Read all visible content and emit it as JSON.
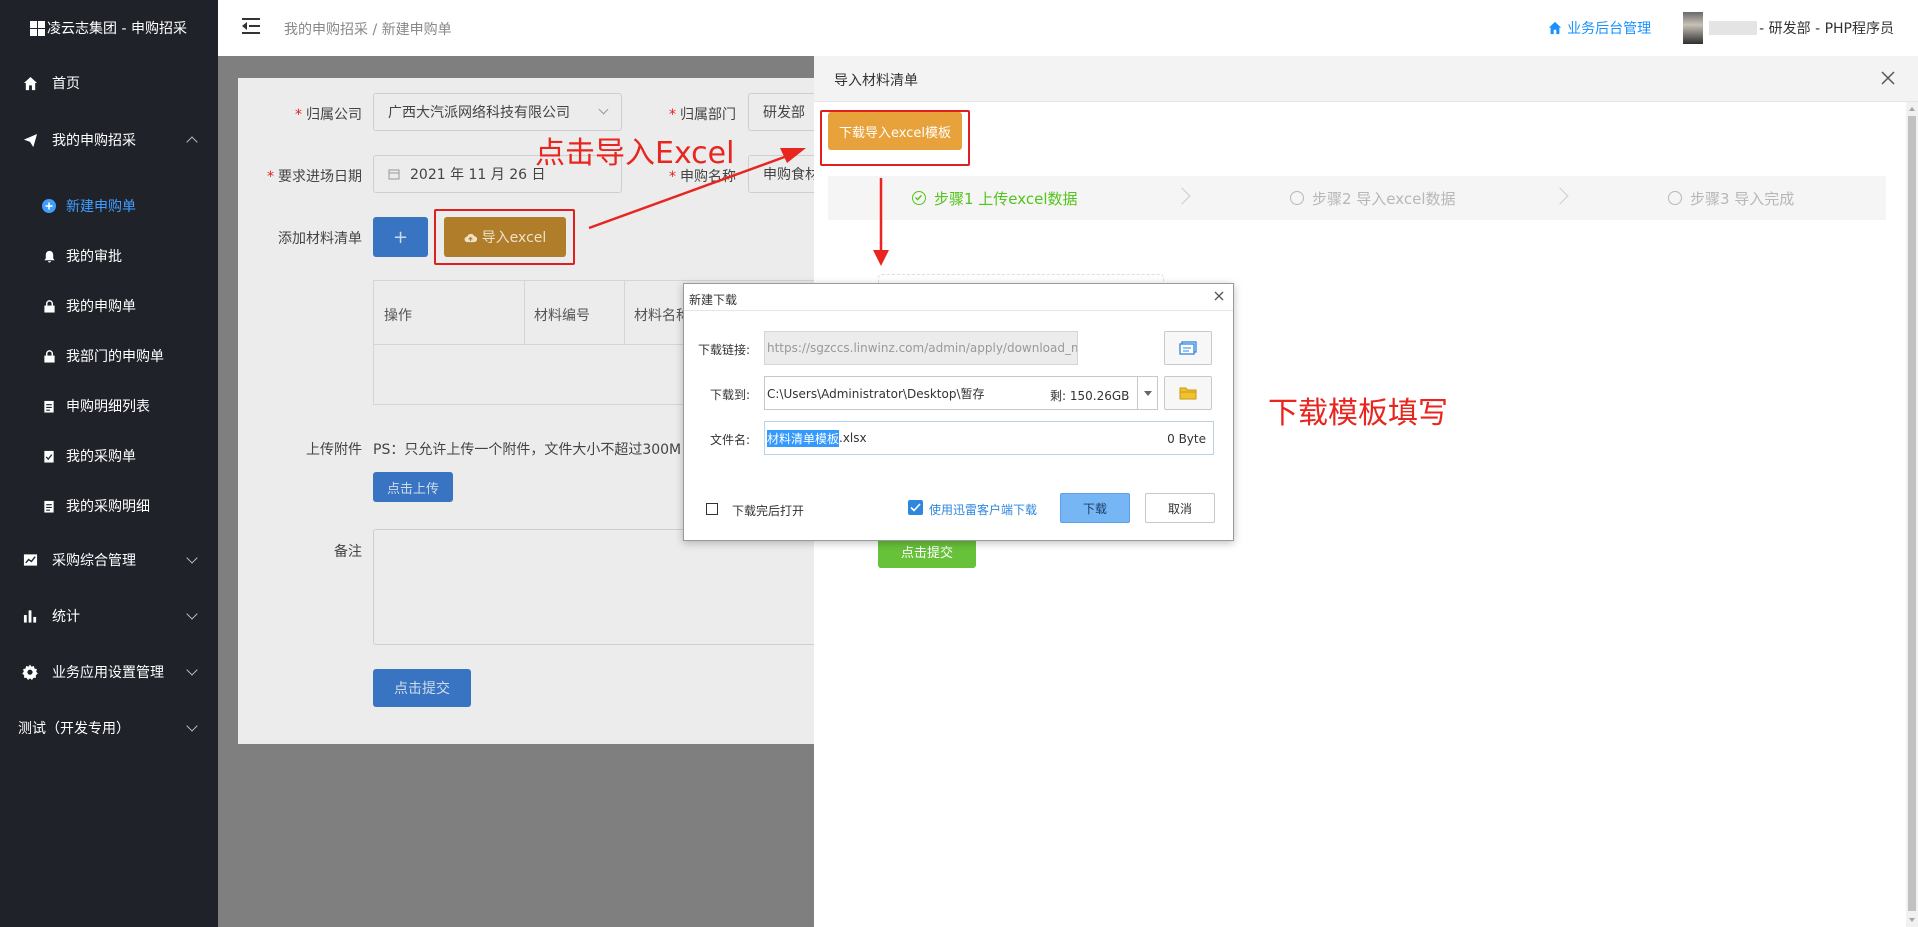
{
  "brand": {
    "title": "凌云志集团 - 申购招采"
  },
  "sidebar": {
    "items": [
      {
        "label": "首页",
        "icon": "home-icon"
      },
      {
        "label": "我的申购招采",
        "icon": "send-icon"
      },
      {
        "label": "采购综合管理",
        "icon": "chart-icon"
      },
      {
        "label": "统计",
        "icon": "bar-chart-icon"
      },
      {
        "label": "业务应用设置管理",
        "icon": "gear-icon"
      },
      {
        "label": "测试（开发专用）",
        "icon": ""
      }
    ],
    "sub_items": [
      {
        "label": "新建申购单",
        "icon": "plus-circle-icon",
        "active": true
      },
      {
        "label": "我的审批",
        "icon": "bell-icon"
      },
      {
        "label": "我的申购单",
        "icon": "lock-icon"
      },
      {
        "label": "我部门的申购单",
        "icon": "lock-icon"
      },
      {
        "label": "申购明细列表",
        "icon": "doc-icon"
      },
      {
        "label": "我的采购单",
        "icon": "check-doc-icon"
      },
      {
        "label": "我的采购明细",
        "icon": "doc-icon"
      }
    ]
  },
  "header": {
    "breadcrumb": "我的申购招采 / 新建申购单",
    "biz_link": "业务后台管理",
    "user": "- 研发部 - PHP程序员"
  },
  "form": {
    "company_label": "归属公司",
    "company_value": "广西大汽派网络科技有限公司",
    "dept_label": "归属部门",
    "dept_value": "研发部",
    "date_label": "要求进场日期",
    "date_value": "2021 年 11 月 26 日",
    "name_label": "申购名称",
    "name_value": "申购食材",
    "materials_label": "添加材料清单",
    "add_btn": "+",
    "import_btn": "导入excel",
    "table_headers": [
      "操作",
      "材料编号",
      "材料名称"
    ],
    "attach_label": "上传附件",
    "attach_note": "PS：只允许上传一个附件，文件大小不超过300M",
    "upload_btn": "点击上传",
    "remark_label": "备注",
    "submit_btn": "点击提交"
  },
  "annotations": {
    "click_import": "点击导入Excel",
    "download_fill": "下载模板填写"
  },
  "panel": {
    "title": "导入材料清单",
    "download_template_btn": "下载导入excel模板",
    "steps": [
      "步骤1 上传excel数据",
      "步骤2 导入excel数据",
      "步骤3 导入完成"
    ],
    "submit_btn": "点击提交"
  },
  "dialog": {
    "title": "新建下载",
    "url_label": "下载链接:",
    "url_value": "https://sgzccs.linwinz.com/admin/apply/download_material_excel",
    "save_label": "下载到:",
    "save_path": "C:\\Users\\Administrator\\Desktop\\暂存",
    "free_space": "剩: 150.26GB",
    "filename_label": "文件名:",
    "filename_selected": "材料清单模板",
    "filename_ext": ".xlsx",
    "file_size": "0 Byte",
    "open_after": "下载完后打开",
    "use_thunder": "使用迅雷客户端下载",
    "download_btn": "下载",
    "cancel_btn": "取消"
  },
  "colors": {
    "accent": "#1890ff",
    "sidebar_bg": "#20222a",
    "annotation_red": "#e8261f",
    "download_orange": "#e8a23b",
    "step_green": "#52c41a"
  }
}
